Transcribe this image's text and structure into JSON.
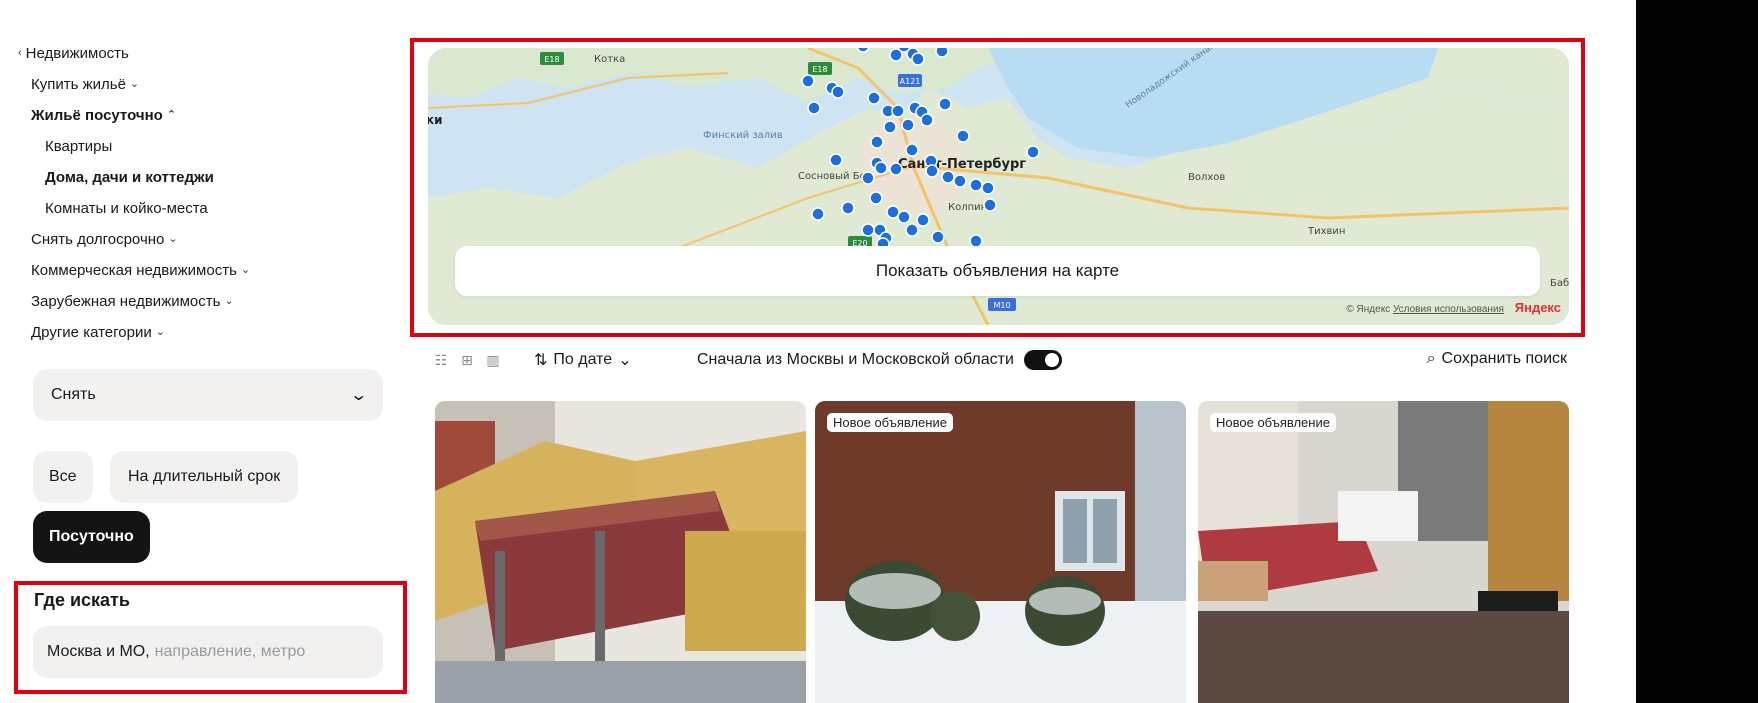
{
  "sidebar": {
    "back_link": "Недвижимость",
    "items": [
      {
        "label": "Купить жильё",
        "chevron": "⌄"
      },
      {
        "label": "Жильё посуточно",
        "chevron": "⌃"
      },
      {
        "label": "Квартиры"
      },
      {
        "label": "Дома, дачи и коттеджи"
      },
      {
        "label": "Комнаты и койко-места"
      },
      {
        "label": "Снять долгосрочно",
        "chevron": "⌄"
      },
      {
        "label": "Коммерческая недвижимость",
        "chevron": "⌄"
      },
      {
        "label": "Зарубежная недвижимость",
        "chevron": "⌄"
      },
      {
        "label": "Другие категории",
        "chevron": "⌄"
      }
    ],
    "deal_select": "Снять",
    "rent_options": [
      "Все",
      "На длительный срок",
      "Посуточно"
    ],
    "rent_selected": "Посуточно",
    "where": {
      "title": "Где искать",
      "value": "Москва и МО,",
      "placeholder": "направление, метро"
    }
  },
  "map": {
    "labels": [
      "Котка",
      "Финский залив",
      "Сосновый Бор",
      "Санкт-Петербург",
      "Колпино",
      "Волхов",
      "Тихвин",
      "Новоладожский канал",
      "ки",
      "Баб"
    ],
    "road_badges": [
      "E18",
      "E18",
      "A121",
      "E20",
      "M10"
    ],
    "show_button": "Показать объявления на карте",
    "copyright": "© Яндекс",
    "terms_link": "Условия использования",
    "brand": "Яндекс",
    "marker_color": "#1e6fd9"
  },
  "toolbar": {
    "view_icons": [
      "list-view-icon",
      "grid-view-icon",
      "map-view-icon"
    ],
    "sort_label": "По дате",
    "region_label": "Сначала из Москвы и Московской области",
    "region_toggle_on": true,
    "save_search": "Сохранить поиск"
  },
  "listings": [
    {
      "badge": ""
    },
    {
      "badge": "Новое объявление"
    },
    {
      "badge": "Новое объявление"
    }
  ],
  "colors": {
    "highlight_box": "#e0000f",
    "accent_dark": "#141414",
    "chip_bg": "#f2f1f0"
  }
}
